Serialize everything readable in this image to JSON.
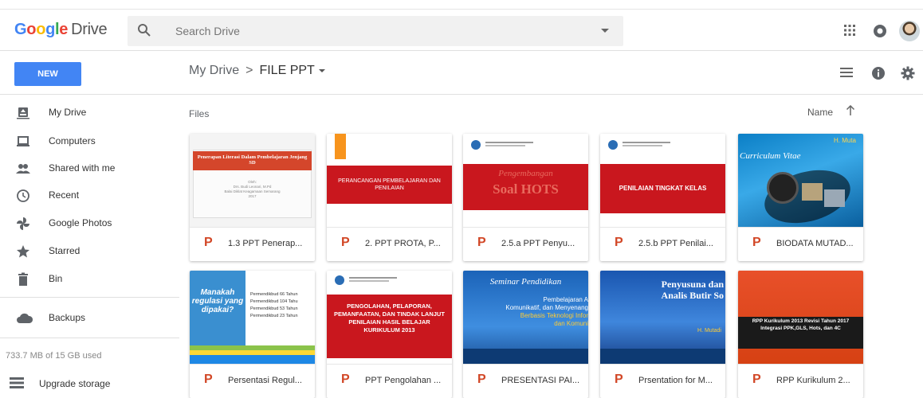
{
  "app": {
    "logo_text": "Google",
    "logo_product": "Drive"
  },
  "search": {
    "placeholder": "Search Drive"
  },
  "toolbar": {
    "new_label": "NEW",
    "breadcrumb_root": "My Drive",
    "breadcrumb_separator": ">",
    "breadcrumb_current": "FILE PPT"
  },
  "sidebar": {
    "items": [
      {
        "label": "My Drive",
        "icon": "drive-icon"
      },
      {
        "label": "Computers",
        "icon": "computer-icon"
      },
      {
        "label": "Shared with me",
        "icon": "people-icon"
      },
      {
        "label": "Recent",
        "icon": "clock-icon"
      },
      {
        "label": "Google Photos",
        "icon": "photos-icon"
      },
      {
        "label": "Starred",
        "icon": "star-icon"
      },
      {
        "label": "Bin",
        "icon": "trash-icon"
      }
    ],
    "backups_label": "Backups",
    "storage_text": "733.7 MB of 15 GB used",
    "upgrade_label": "Upgrade storage"
  },
  "main": {
    "section_label": "Files",
    "sort_label": "Name"
  },
  "files": [
    {
      "name": "1.3 PPT Penerap...",
      "thumb": {
        "title": "Penerapan Literasi Dalam Pembelajaran Jenjang SD",
        "line1": "Oleh:",
        "line2": "Drs. Budi Leonari, M.Pd",
        "line3": "Balai Diklat Keagamaan Semarang",
        "line4": "2017"
      }
    },
    {
      "name": "2. PPT PROTA, P...",
      "thumb": {
        "title": "PERANCANGAN PEMBELAJARAN DAN PENILAIAN"
      }
    },
    {
      "name": "2.5.a PPT Penyu...",
      "thumb": {
        "title": "Soal HOTS",
        "sub": "Pengembangan"
      }
    },
    {
      "name": "2.5.b PPT Penilai...",
      "thumb": {
        "title": "PENILAIAN TINGKAT KELAS"
      }
    },
    {
      "name": "BIODATA MUTAD...",
      "thumb": {
        "title": "Curriculum Vitae",
        "sub": "H. Muta"
      }
    },
    {
      "name": "Persentasi Regul...",
      "thumb": {
        "title": "Manakah regulasi yang dipakai?",
        "line1": "Permendikbud 66 Tahun",
        "line2": "Permendikbud 104 Tahu",
        "line3": "Permendikbud 53 Tahun",
        "line4": "Permendikbud 23 Tahun"
      }
    },
    {
      "name": "PPT Pengolahan ...",
      "thumb": {
        "title": "PENGOLAHAN, PELAPORAN, PEMANFAATAN, DAN TINDAK LANJUT PENILAIAN HASIL BELAJAR KURIKULUM 2013"
      }
    },
    {
      "name": "PRESENTASI PAI...",
      "thumb": {
        "title": "Seminar Pendidikan",
        "line1": "Pembelajaran A",
        "line2": "Komunikatif, dan Menyenang",
        "line3": "Berbasis Teknologi Infor",
        "line4": "dan Komuni"
      }
    },
    {
      "name": "Prsentation for M...",
      "thumb": {
        "title": "Penyusuna dan Analis Butir So",
        "sub": "H. Mutadi"
      }
    },
    {
      "name": "RPP Kurikulum 2...",
      "thumb": {
        "title": "RPP Kurikulum 2013 Revisi Tahun 2017 Integrasi PPK,GLS, Hots, dan 4C"
      }
    }
  ],
  "colors": {
    "accent": "#4285f4",
    "ppt_icon": "#d24726",
    "slide_red": "#c9171e",
    "slide_orange": "#f7941d"
  }
}
